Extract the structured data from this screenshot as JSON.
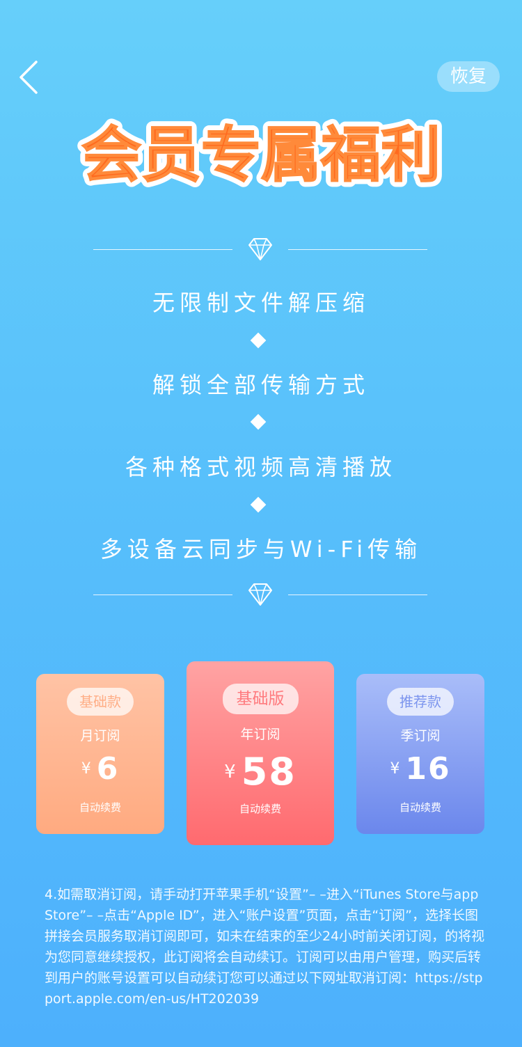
{
  "nav": {
    "back_icon": "chevron-left-icon",
    "restore_label": "恢复"
  },
  "hero": {
    "title": "会员专属福利",
    "title_colors": {
      "fill": "#ff6a1e",
      "outline": "#ffffff"
    }
  },
  "features": [
    "无限制文件解压缩",
    "解锁全部传输方式",
    "各种格式视频高清播放",
    "多设备云同步与Wi-Fi传输"
  ],
  "plans": [
    {
      "badge": "基础款",
      "name": "月订阅",
      "currency": "¥",
      "price": "6",
      "renew": "自动续费"
    },
    {
      "badge": "基础版",
      "name": "年订阅",
      "currency": "¥",
      "price": "58",
      "renew": "自动续费"
    },
    {
      "badge": "推荐款",
      "name": "季订阅",
      "currency": "¥",
      "price": "16",
      "renew": "自动续费"
    }
  ],
  "terms": "4.如需取消订阅，请手动打开苹果手机“设置”– –进入“iTunes Store与app Store”– –点击“Apple ID”，进入“账户设置”页面，点击“订阅”，选择长图拼接会员服务取消订阅即可，如未在结束的至少24小时前关闭订阅，的将视为您同意继续授权，此订阅将会自动续订。订阅可以由用户管理，购买后转到用户的账号设置可以自动续订您可以通过以下网址取消订阅：https://stpport.apple.com/en-us/HT202039",
  "colors": {
    "background_top": "#66cffa",
    "background_bottom": "#4db0fc",
    "card_month": "#ffaa80",
    "card_year": "#ff6a6f",
    "card_season": "#6b87ec"
  }
}
